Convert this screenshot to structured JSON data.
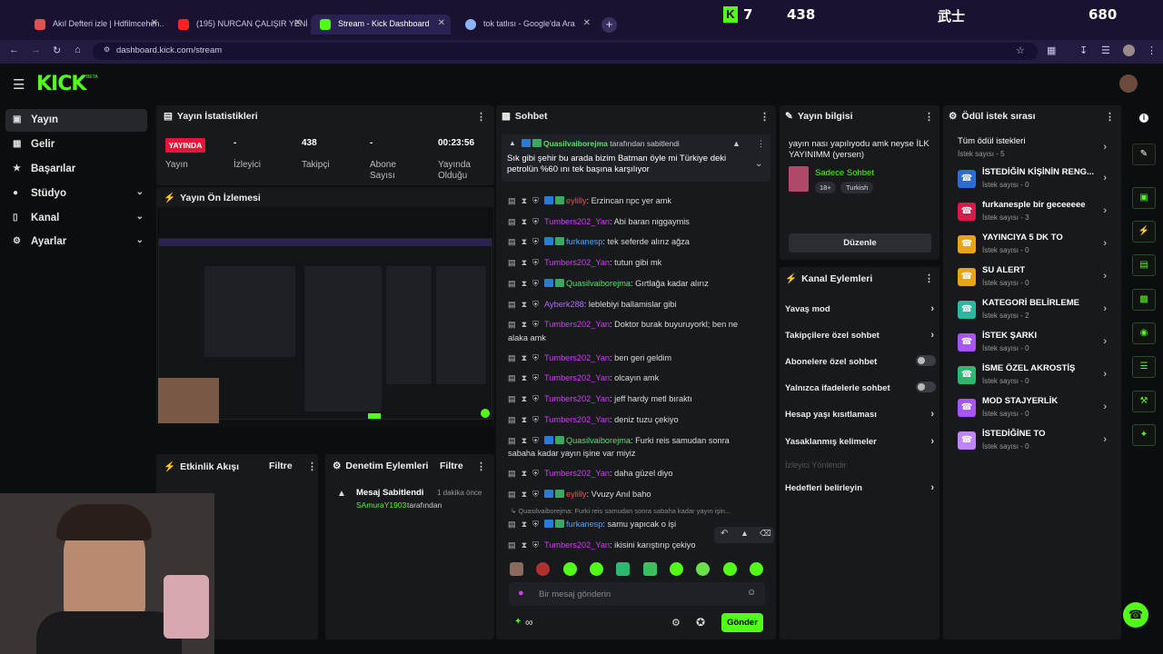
{
  "browser": {
    "tabs": [
      {
        "title": "Akıl Defteri izle | Hdfilmcehen...",
        "color": "#e05050"
      },
      {
        "title": "(195) NURCAN ÇALIŞIR YENİ Y...",
        "color": "#ff2020"
      },
      {
        "title": "Stream - Kick Dashboard",
        "color": "#53fc18"
      },
      {
        "title": "tok tatlısı - Google'da Ara",
        "color": "#8ab4f8"
      }
    ],
    "url": "dashboard.kick.com/stream",
    "close_glyph": "✕",
    "new_tab": "+"
  },
  "game_overlay": {
    "k": "7",
    "score1": "438",
    "kanji": "武士",
    "score2": "680"
  },
  "header": {
    "logo": "KICK",
    "beta": "BETA"
  },
  "sidebar": {
    "items": [
      {
        "label": "Yayın",
        "icon": "camera-icon"
      },
      {
        "label": "Gelir",
        "icon": "money-icon"
      },
      {
        "label": "Başarılar",
        "icon": "trophy-icon"
      },
      {
        "label": "Stüdyo",
        "icon": "studio-icon"
      },
      {
        "label": "Kanal",
        "icon": "channel-icon"
      },
      {
        "label": "Ayarlar",
        "icon": "gear-icon"
      }
    ]
  },
  "stats": {
    "title": "Yayın İstatistikleri",
    "live": "YAYINDA",
    "items": [
      {
        "value": "",
        "label": "Yayın"
      },
      {
        "value": "-",
        "label": "İzleyici"
      },
      {
        "value": "438",
        "label": "Takipçi"
      },
      {
        "value": "-",
        "label": "Abone\nSayısı"
      },
      {
        "value": "00:23:56",
        "label": "Yayında\nOlduğu"
      }
    ]
  },
  "preview": {
    "title": "Yayın Ön İzlemesi"
  },
  "activity": {
    "title": "Etkinlik Akışı",
    "filter": "Filtre"
  },
  "moderation": {
    "title": "Denetim Eylemleri",
    "filter": "Filtre",
    "event_title": "Mesaj Sabitlendi",
    "event_time": "1 dakika önce",
    "event_user": "SAmuraY1903",
    "event_suffix": "tarafından"
  },
  "chat": {
    "title": "Sohbet",
    "pinned_by": "Quasilvaiborejma",
    "pinned_suffix": "tarafından sabitlendi",
    "pinned_text": "Sık gibi şehir bu arada bizim Batman öyle mi Türkiye deki petrolün %60 ını tek başına karşılıyor",
    "messages": [
      {
        "user": "eylilly",
        "color": "u-red",
        "text": ": Erzincan npc yer amk"
      },
      {
        "user": "Tumbers202_Yan",
        "color": "u-pink",
        "text": ": Abi baran niggaymis"
      },
      {
        "user": "furkanesp",
        "color": "u-blue",
        "text": ": tek seferde alırız ağza"
      },
      {
        "user": "Tumbers202_Yan",
        "color": "u-pink",
        "text": ": tutun gibi mk"
      },
      {
        "user": "Quasilvaiborejma",
        "color": "u-green",
        "text": ": Gırtlağa kadar alırız"
      },
      {
        "user": "Ayberk288",
        "color": "u-purple",
        "text": ": leblebiyi ballamislar gibi"
      },
      {
        "user": "Tumbers202_Yan",
        "color": "u-pink",
        "text": ": Doktor burak buyuruyorkl; ben ne"
      },
      {
        "user": "",
        "color": "",
        "text": "alaka amk"
      },
      {
        "user": "Tumbers202_Yan",
        "color": "u-pink",
        "text": ": ben geri geldim"
      },
      {
        "user": "Tumbers202_Yan",
        "color": "u-pink",
        "text": ": olcayın amk"
      },
      {
        "user": "Tumbers202_Yan",
        "color": "u-pink",
        "text": ": jeff hardy metl bıraktı"
      },
      {
        "user": "Tumbers202_Yan",
        "color": "u-pink",
        "text": ": deniz tuzu çekiyo"
      },
      {
        "user": "Quasilvaiborejma",
        "color": "u-green",
        "text": ": Furki reis samudan sonra"
      },
      {
        "user": "",
        "color": "",
        "text": "sabaha kadar yayın işine var miyiz"
      },
      {
        "user": "Tumbers202_Yan",
        "color": "u-pink",
        "text": ": daha güzel diyo"
      },
      {
        "user": "eylilly",
        "color": "u-red",
        "text": ": Vvuzy Anıl baho"
      },
      {
        "user": "",
        "color": "",
        "text": "↳ Quasilvaiborejma: Furki reis samudan sonra sabaha kadar yayın işin..."
      },
      {
        "user": "furkanesp",
        "color": "u-blue",
        "text": ": samu yapıcak o işi"
      },
      {
        "user": "Tumbers202_Yan",
        "color": "u-pink",
        "text": ": ikisini karıştırıp çekiyo"
      }
    ],
    "placeholder": "Bir mesaj gönderin",
    "send": "Gönder",
    "infinity": "∞"
  },
  "stream_info": {
    "title": "Yayın bilgisi",
    "stream_title": "yayın nası yapılıyodu amk neyse İLK YAYINIMM (yersen)",
    "category": "Sadece Sohbet",
    "tags": [
      "18+",
      "Turkish"
    ],
    "edit": "Düzenle"
  },
  "channel_actions": {
    "title": "Kanal Eylemleri",
    "items": [
      {
        "label": "Yavaş mod",
        "type": "chevron"
      },
      {
        "label": "Takipçilere özel sohbet",
        "type": "chevron"
      },
      {
        "label": "Abonelere özel sohbet",
        "type": "toggle"
      },
      {
        "label": "Yalnızca ifadelerle sohbet",
        "type": "toggle"
      },
      {
        "label": "Hesap yaşı kısıtlaması",
        "type": "chevron"
      },
      {
        "label": "Yasaklanmış kelimeler",
        "type": "chevron"
      }
    ],
    "viewer_section": "İzleyici Yönlendir",
    "goals": "Hedefleri belirleyin"
  },
  "rewards": {
    "title": "Ödül istek sırası",
    "all": "Tüm ödül istekleri",
    "all_count": "İstek sayısı - 5",
    "items": [
      {
        "name": "İSTEDİĞİN KİŞİNİN RENG...",
        "count": "İstek sayısı - 0",
        "color": "#2b6cd8"
      },
      {
        "name": "furkanesple bir geceeeee",
        "count": "İstek sayısı - 3",
        "color": "#d81b4a"
      },
      {
        "name": "YAYINCIYA 5 DK TO",
        "count": "İstek sayısı - 0",
        "color": "#e8a317"
      },
      {
        "name": "SU ALERT",
        "count": "İstek sayısı - 0",
        "color": "#e8a317"
      },
      {
        "name": "KATEGORİ BELİRLEME",
        "count": "İstek sayısı - 2",
        "color": "#2bb8a0"
      },
      {
        "name": "İSTEK ŞARKI",
        "count": "İstek sayısı - 0",
        "color": "#a855f7"
      },
      {
        "name": "İSME ÖZEL AKROSTİŞ",
        "count": "İstek sayısı - 0",
        "color": "#2bb870"
      },
      {
        "name": "MOD STAJYERLİK",
        "count": "İstek sayısı - 0",
        "color": "#a855f7"
      },
      {
        "name": "İSTEDİĞİNE TO",
        "count": "İstek sayısı - 0",
        "color": "#c084fc"
      }
    ]
  }
}
